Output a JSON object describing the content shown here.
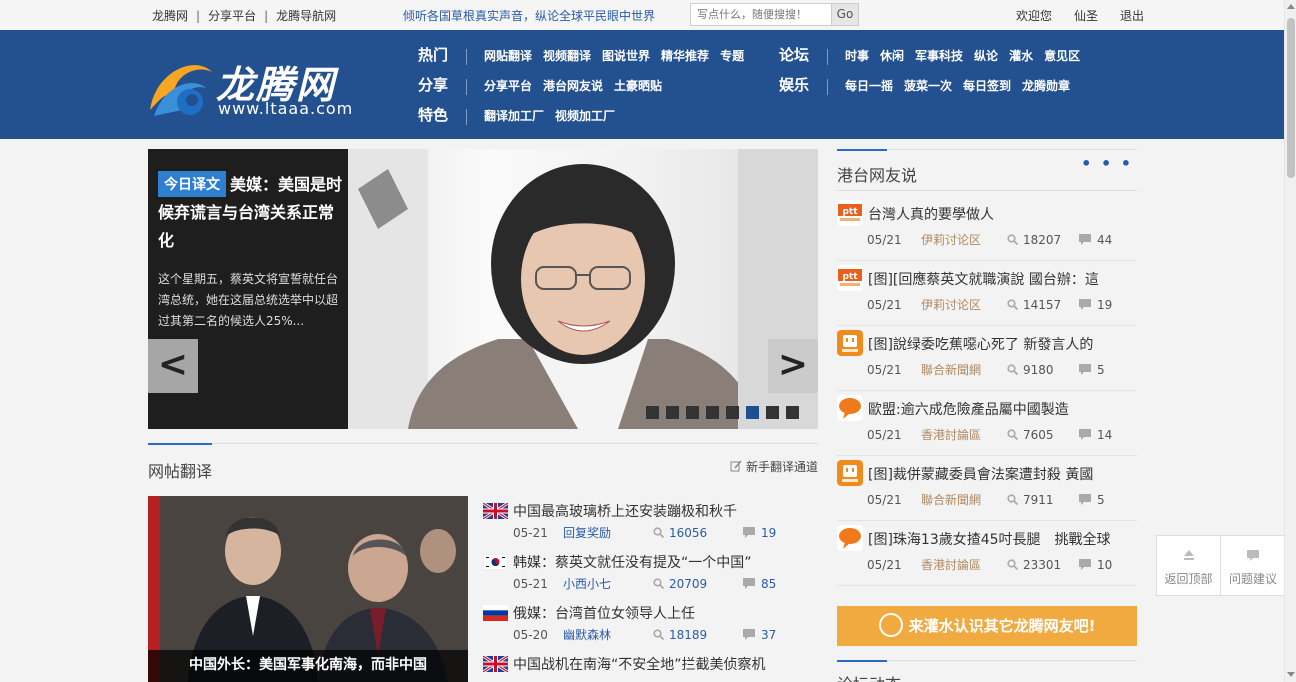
{
  "topbar": {
    "links": [
      "龙腾网",
      "分享平台",
      "龙腾导航网"
    ],
    "slogan": "倾听各国草根真实声音，纵论全球平民眼中世界",
    "search_placeholder": "写点什么，随便搜搜！",
    "search_button": "Go",
    "user": [
      "欢迎您",
      "仙圣",
      "退出"
    ]
  },
  "logo": {
    "cn": "龙腾网",
    "en": "www.ltaaa.com"
  },
  "nav": {
    "rows": [
      {
        "cat": "热门",
        "items": [
          "网贴翻译",
          "视频翻译",
          "图说世界",
          "精华推荐",
          "专题"
        ]
      },
      {
        "cat": "分享",
        "items": [
          "分享平台",
          "港台网友说",
          "土豪晒贴"
        ]
      },
      {
        "cat": "特色",
        "items": [
          "翻译加工厂",
          "视频加工厂"
        ]
      }
    ],
    "rows_right": [
      {
        "cat": "论坛",
        "items": [
          "时事",
          "休闲",
          "军事科技",
          "纵论",
          "灌水",
          "意见区"
        ]
      },
      {
        "cat": "娱乐",
        "items": [
          "每日一摇",
          "菠菜一次",
          "每日签到",
          "龙腾勋章"
        ]
      }
    ]
  },
  "slider": {
    "tag": "今日译文",
    "headline": "美媒：美国是时候弃谎言与台湾关系正常化",
    "summary": "这个星期五，蔡英文将宣誓就任台湾总统，她在这届总统选举中以超过其第二名的候选人25%...",
    "prev": "<",
    "next": ">",
    "dot_count": 8,
    "active_dot": 5
  },
  "translation": {
    "title": "网帖翻译",
    "link": "新手翻译通道",
    "feature_caption": "中国外长：美国军事化南海，而非中国",
    "items": [
      {
        "flag": "uk",
        "title": "中国最高玻璃桥上还安装蹦极和秋千",
        "date": "05-21",
        "user": "回复奖励",
        "views": "16056",
        "comments": "19"
      },
      {
        "flag": "kr",
        "title": "韩媒：蔡英文就任没有提及“一个中国”",
        "date": "05-21",
        "user": "小西小七",
        "views": "20709",
        "comments": "85"
      },
      {
        "flag": "ru",
        "title": "俄媒：台湾首位女领导人上任",
        "date": "05-20",
        "user": "幽默森林",
        "views": "18189",
        "comments": "37"
      },
      {
        "flag": "uk",
        "title": "中国战机在南海“不安全地”拦截美侦察机",
        "date": "",
        "user": "",
        "views": "",
        "comments": ""
      }
    ]
  },
  "friends": {
    "title": "港台网友说",
    "more": "• • •",
    "items": [
      {
        "icon": "ptt",
        "title": "台灣人真的要學做人",
        "date": "05/21",
        "source": "伊莉讨论区",
        "views": "18207",
        "comments": "44"
      },
      {
        "icon": "ptt",
        "title": "[图][回應蔡英文就職演說 國台辦：這",
        "date": "05/21",
        "source": "伊莉讨论区",
        "views": "14157",
        "comments": "19"
      },
      {
        "icon": "udn",
        "title": "[图]說绿委吃蕉噁心死了 新發言人的",
        "date": "05/21",
        "source": "聯合新聞網",
        "views": "9180",
        "comments": "5"
      },
      {
        "icon": "bubble",
        "title": "歐盟:逾六成危險產品屬中國製造",
        "date": "05/21",
        "source": "香港討論區",
        "views": "7605",
        "comments": "14"
      },
      {
        "icon": "udn",
        "title": "[图]裁併蒙藏委員會法案遭封殺 黃國",
        "date": "05/21",
        "source": "聯合新聞網",
        "views": "7911",
        "comments": "5"
      },
      {
        "icon": "bubble",
        "title": "[图]珠海13歲女揸45吋長腿　挑戰全球",
        "date": "05/21",
        "source": "香港討論區",
        "views": "23301",
        "comments": "10"
      }
    ]
  },
  "cta": "来灌水认识其它龙腾网友吧!",
  "forum_title": "论坛动态",
  "float": {
    "top": "返回顶部",
    "feedback": "问题建议"
  },
  "colors": {
    "header": "#23508f",
    "accent": "#2a6cc4",
    "cta": "#f0aa40"
  }
}
